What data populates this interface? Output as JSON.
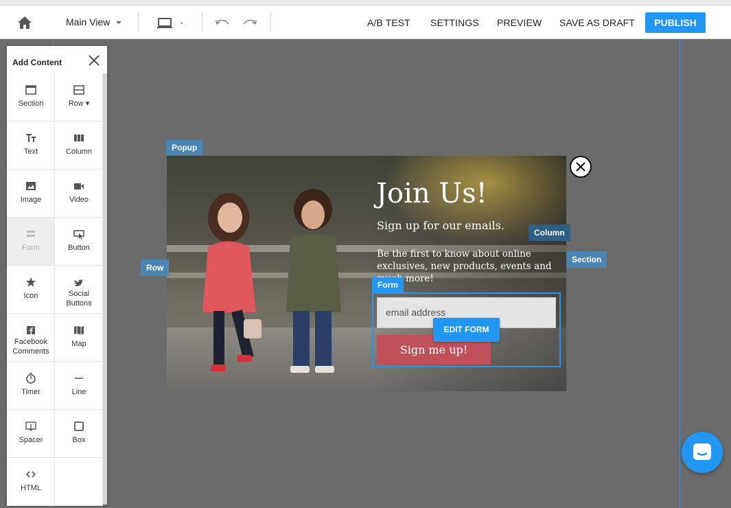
{
  "toolbar": {
    "view_label": "Main View",
    "ab_test": "A/B TEST",
    "settings": "SETTINGS",
    "preview": "PREVIEW",
    "save_draft": "SAVE AS DRAFT",
    "publish": "PUBLISH"
  },
  "panel": {
    "title": "Add Content",
    "items": [
      {
        "label": "Section",
        "icon": "section-icon"
      },
      {
        "label": "Row ▾",
        "icon": "row-icon"
      },
      {
        "label": "Text",
        "icon": "text-icon"
      },
      {
        "label": "Column",
        "icon": "column-icon"
      },
      {
        "label": "Image",
        "icon": "image-icon"
      },
      {
        "label": "Video",
        "icon": "video-icon"
      },
      {
        "label": "Form",
        "icon": "form-icon"
      },
      {
        "label": "Button",
        "icon": "button-icon"
      },
      {
        "label": "Icon",
        "icon": "star-icon"
      },
      {
        "label": "Social Buttons",
        "icon": "twitter-icon"
      },
      {
        "label": "Facebook Comments",
        "icon": "facebook-icon"
      },
      {
        "label": "Map",
        "icon": "map-icon"
      },
      {
        "label": "Timer",
        "icon": "timer-icon"
      },
      {
        "label": "Line",
        "icon": "line-icon"
      },
      {
        "label": "Spacer",
        "icon": "spacer-icon"
      },
      {
        "label": "Box",
        "icon": "box-icon"
      },
      {
        "label": "HTML",
        "icon": "code-icon"
      }
    ]
  },
  "tags": {
    "popup": "Popup",
    "row": "Row",
    "column": "Column",
    "section": "Section",
    "form": "Form"
  },
  "popup": {
    "title": "Join Us!",
    "subtitle": "Sign up for our emails.",
    "body": "Be the first to know about online exclusives, new products, events and much more!",
    "email_placeholder": "email address",
    "submit_label": "Sign me up!",
    "edit_form_label": "EDIT FORM"
  },
  "colors": {
    "accent": "#2196f3",
    "tag_bg": "#4a86b4",
    "tag_dark": "#2f5f85",
    "submit": "#c0515a"
  }
}
